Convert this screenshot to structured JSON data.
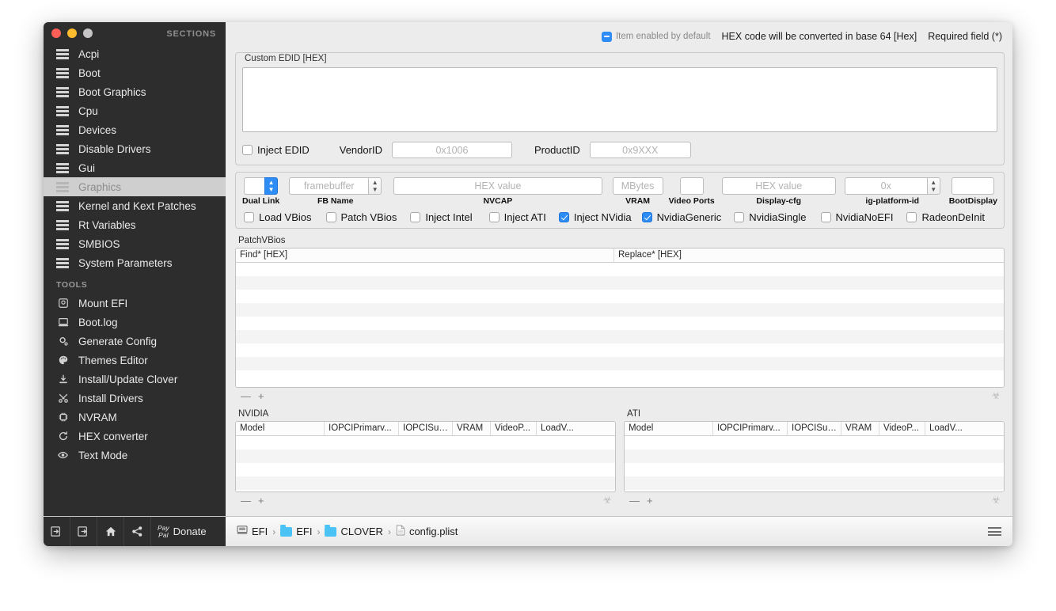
{
  "window": {
    "sections_label": "SECTIONS",
    "tools_label": "TOOLS"
  },
  "sidebar": {
    "sections": [
      {
        "label": "Acpi",
        "icon": "list-icon"
      },
      {
        "label": "Boot",
        "icon": "list-icon"
      },
      {
        "label": "Boot Graphics",
        "icon": "list-icon"
      },
      {
        "label": "Cpu",
        "icon": "list-icon"
      },
      {
        "label": "Devices",
        "icon": "list-icon"
      },
      {
        "label": "Disable Drivers",
        "icon": "list-icon"
      },
      {
        "label": "Gui",
        "icon": "list-icon"
      },
      {
        "label": "Graphics",
        "icon": "list-icon",
        "selected": true
      },
      {
        "label": "Kernel and Kext Patches",
        "icon": "list-icon"
      },
      {
        "label": "Rt Variables",
        "icon": "list-icon"
      },
      {
        "label": "SMBIOS",
        "icon": "list-icon"
      },
      {
        "label": "System Parameters",
        "icon": "list-icon"
      }
    ],
    "tools": [
      {
        "label": "Mount EFI",
        "icon": "disk-icon"
      },
      {
        "label": "Boot.log",
        "icon": "computer-icon"
      },
      {
        "label": "Generate Config",
        "icon": "gear-icon"
      },
      {
        "label": "Themes Editor",
        "icon": "palette-icon"
      },
      {
        "label": "Install/Update Clover",
        "icon": "download-icon"
      },
      {
        "label": "Install Drivers",
        "icon": "tools-icon"
      },
      {
        "label": "NVRAM",
        "icon": "chip-icon"
      },
      {
        "label": "HEX converter",
        "icon": "refresh-icon"
      },
      {
        "label": "Text Mode",
        "icon": "eye-icon"
      }
    ]
  },
  "topbar": {
    "item_enabled_label": "Item enabled by default",
    "hex_note": "HEX code will be converted in base 64 [Hex]",
    "required_note": "Required field (*)"
  },
  "edid": {
    "panel_title": "Custom EDID [HEX]",
    "textarea_value": "",
    "inject_edid_label": "Inject EDID",
    "inject_edid_checked": false,
    "vendor_id_label": "VendorID",
    "vendor_id_placeholder": "0x1006",
    "product_id_label": "ProductID",
    "product_id_placeholder": "0x9XXX"
  },
  "controls": {
    "dual_link": {
      "caption": "Dual Link",
      "value": ""
    },
    "fb_name": {
      "caption": "FB Name",
      "placeholder": "framebuffer"
    },
    "nvcap": {
      "caption": "NVCAP",
      "placeholder": "HEX value"
    },
    "vram": {
      "caption": "VRAM",
      "placeholder": "MBytes"
    },
    "video_ports": {
      "caption": "Video Ports",
      "value": ""
    },
    "display_cfg": {
      "caption": "Display-cfg",
      "placeholder": "HEX value"
    },
    "ig_platform_id": {
      "caption": "ig-platform-id",
      "placeholder": "0x"
    },
    "boot_display": {
      "caption": "BootDisplay",
      "value": ""
    },
    "checkboxes": [
      {
        "label": "Load VBios",
        "checked": false
      },
      {
        "label": "Patch VBios",
        "checked": false
      },
      {
        "label": "Inject Intel",
        "checked": false
      },
      {
        "label": "Inject ATI",
        "checked": false
      },
      {
        "label": "Inject NVidia",
        "checked": true
      },
      {
        "label": "NvidiaGeneric",
        "checked": true
      },
      {
        "label": "NvidiaSingle",
        "checked": false
      },
      {
        "label": "NvidiaNoEFI",
        "checked": false
      },
      {
        "label": "RadeonDeInit",
        "checked": false
      }
    ]
  },
  "patchvbios": {
    "caption": "PatchVBios",
    "columns": [
      "Find* [HEX]",
      "Replace* [HEX]"
    ],
    "rows": [],
    "row_count": 9,
    "remove_label": "—",
    "add_label": "+"
  },
  "nvidia_table": {
    "caption": "NVIDIA",
    "columns": [
      "Model",
      "IOPCIPrimarv...",
      "IOPCISubD...",
      "VRAM",
      "VideoP...",
      "LoadV..."
    ],
    "rows": [],
    "row_count": 4,
    "remove_label": "—",
    "add_label": "+"
  },
  "ati_table": {
    "caption": "ATI",
    "columns": [
      "Model",
      "IOPCIPrimarv...",
      "IOPCISubD...",
      "VRAM",
      "VideoP...",
      "LoadV..."
    ],
    "rows": [],
    "row_count": 4,
    "remove_label": "—",
    "add_label": "+"
  },
  "bottombar": {
    "donate_label": "Donate",
    "paypal_line1": "Pay",
    "paypal_line2": "Pal",
    "breadcrumb": [
      {
        "label": "EFI",
        "icon": "disk-icon"
      },
      {
        "label": "EFI",
        "icon": "folder-icon"
      },
      {
        "label": "CLOVER",
        "icon": "folder-icon"
      },
      {
        "label": "config.plist",
        "icon": "file-icon"
      }
    ],
    "separator": "›"
  },
  "colors": {
    "accent": "#2d8cf5",
    "sidebar_bg": "#2d2d2d",
    "panel_bg": "#ececec",
    "folder_blue": "#4cc3f5"
  }
}
